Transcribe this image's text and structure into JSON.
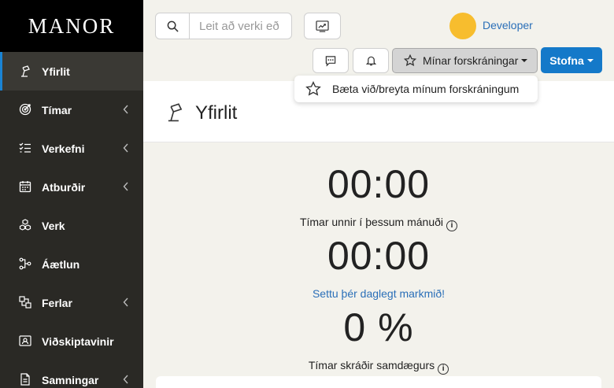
{
  "app": {
    "logo": "MANOR"
  },
  "sidebar": {
    "items": [
      {
        "label": "Yfirlit",
        "icon": "lamp-icon",
        "active": true,
        "chevron": false
      },
      {
        "label": "Tímar",
        "icon": "target-icon",
        "active": false,
        "chevron": true
      },
      {
        "label": "Verkefni",
        "icon": "checklist-icon",
        "active": false,
        "chevron": true
      },
      {
        "label": "Atburðir",
        "icon": "calendar-icon",
        "active": false,
        "chevron": true
      },
      {
        "label": "Verk",
        "icon": "cubes-icon",
        "active": false,
        "chevron": false
      },
      {
        "label": "Áætlun",
        "icon": "flow-icon",
        "active": false,
        "chevron": false
      },
      {
        "label": "Ferlar",
        "icon": "chart-icon",
        "active": false,
        "chevron": true
      },
      {
        "label": "Viðskiptavinir",
        "icon": "contacts-icon",
        "active": false,
        "chevron": false
      },
      {
        "label": "Samningar",
        "icon": "document-icon",
        "active": false,
        "chevron": true
      }
    ]
  },
  "header": {
    "search_placeholder": "Leit að verki eð",
    "user_name": "Developer",
    "favorites_label": "Mínar forskráningar",
    "create_label": "Stofna"
  },
  "dropdown": {
    "item_label": "Bæta við/breyta mínum forskráningum"
  },
  "main": {
    "title": "Yfirlit",
    "hours_month_value": "00:00",
    "hours_month_caption": "Tímar unnir í þessum mánuði",
    "daily_value": "00:00",
    "daily_goal_link": "Settu þér daglegt markmið!",
    "same_day_value": "0 %",
    "same_day_caption": "Tímar skráðir samdægurs",
    "info_glyph": "i"
  },
  "colors": {
    "sidebar_bg": "#2a2925",
    "logo_bg": "#000000",
    "accent": "#1479c9",
    "link": "#2a6fb8",
    "avatar": "#f7bd2e",
    "page_bg": "#f3f2ec"
  }
}
